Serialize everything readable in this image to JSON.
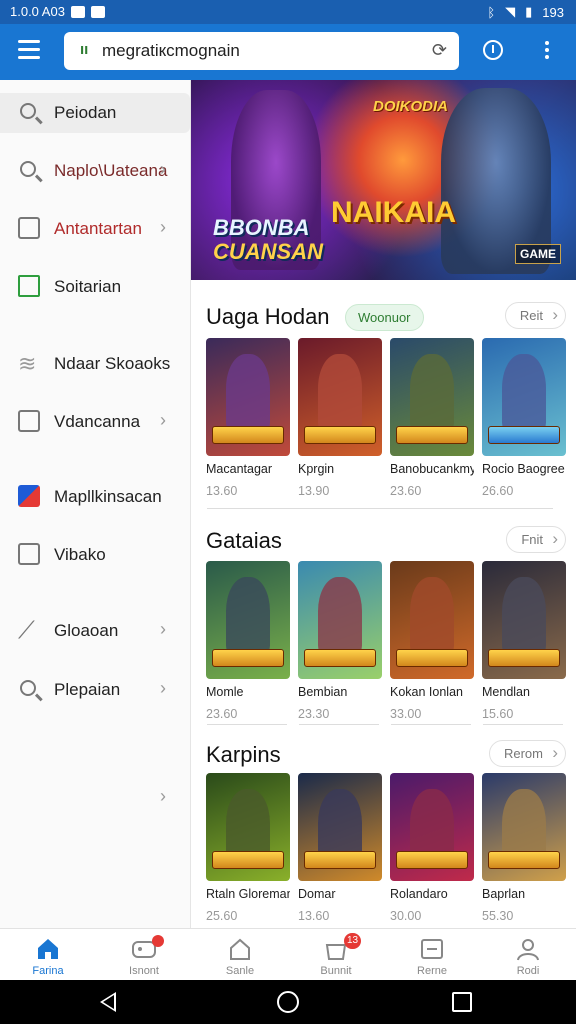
{
  "status_bar": {
    "time": "1.0.0 A03",
    "right_text": "193"
  },
  "browser": {
    "url": "megratiкcmognain"
  },
  "sidebar": {
    "search_label": "Peiodan",
    "items": [
      {
        "label": "Naplo\\Uateana",
        "icon": "search-icon",
        "color": "#7a2a2a"
      },
      {
        "label": "Antantartan",
        "icon": "grid-icon",
        "color": "#b02a2a"
      },
      {
        "label": "Soitarian",
        "icon": "image-icon",
        "color": "#222222"
      },
      {
        "label": "Ndaar Skoaoks",
        "icon": "wave-icon",
        "color": "#222222"
      },
      {
        "label": "Vdancanna",
        "icon": "check-box-icon",
        "color": "#222222"
      },
      {
        "label": "Mapllkinsacan",
        "icon": "flag-icon",
        "color": "#222222"
      },
      {
        "label": "Vibako",
        "icon": "doc-icon",
        "color": "#222222"
      },
      {
        "label": "Gloaoan",
        "icon": "pen-icon",
        "color": "#222222"
      },
      {
        "label": "Plepaian",
        "icon": "search-icon",
        "color": "#222222"
      }
    ]
  },
  "hero": {
    "top_title": "DOIKODIA",
    "main_title": "NAIKAIA",
    "left_title_1": "BBONBA",
    "left_title_2": "CUANSAN",
    "badge": "GAME"
  },
  "sections": [
    {
      "title": "Uaga Hodan",
      "pill": "Woonuor",
      "more": "Reit",
      "cards": [
        {
          "name": "Macantagar",
          "price": "13.60",
          "colors": [
            "#3a2a5a",
            "#c04a3a"
          ]
        },
        {
          "name": "Kprgin",
          "price": "13.90",
          "colors": [
            "#6a1a2a",
            "#d0602a"
          ]
        },
        {
          "name": "Banobucankmy",
          "price": "23.60",
          "colors": [
            "#2a4a6a",
            "#6a8a3a"
          ]
        },
        {
          "name": "Rocio Baogree",
          "price": "26.60",
          "colors": [
            "#2a6ab0",
            "#6ac0d0"
          ]
        }
      ]
    },
    {
      "title": "Gataias",
      "more": "Fnit",
      "cards": [
        {
          "name": "Momle",
          "price": "23.60",
          "colors": [
            "#2a5a4a",
            "#7ab04a"
          ]
        },
        {
          "name": "Bembian",
          "price": "23.30",
          "colors": [
            "#3a8ab0",
            "#9ad06a"
          ]
        },
        {
          "name": "Kokan Ionlan",
          "price": "33.00",
          "colors": [
            "#6a3a1a",
            "#d06a2a"
          ]
        },
        {
          "name": "Mendlan",
          "price": "15.60",
          "colors": [
            "#2a2a3a",
            "#8a6a4a"
          ]
        }
      ]
    },
    {
      "title": "Karpins",
      "more": "Rerom",
      "cards": [
        {
          "name": "Rtaln Gloreman",
          "price": "25.60",
          "colors": [
            "#2a4a1a",
            "#8ab02a"
          ]
        },
        {
          "name": "Domar",
          "price": "13.60",
          "colors": [
            "#1a2a4a",
            "#d08a2a"
          ]
        },
        {
          "name": "Rolandaro",
          "price": "30.00",
          "colors": [
            "#4a1a6a",
            "#c02a4a"
          ]
        },
        {
          "name": "Baprlan",
          "price": "55.30",
          "colors": [
            "#2a3a6a",
            "#d0a04a"
          ]
        }
      ]
    }
  ],
  "bottom_nav": [
    {
      "label": "Farina",
      "icon": "home-icon",
      "active": true,
      "badge": ""
    },
    {
      "label": "Isnont",
      "icon": "gamepad-icon",
      "active": false,
      "badge": ""
    },
    {
      "label": "Sanle",
      "icon": "house-outline-icon",
      "active": false,
      "badge": ""
    },
    {
      "label": "Bunnit",
      "icon": "bag-icon",
      "active": false,
      "badge": "13"
    },
    {
      "label": "Rerne",
      "icon": "box-icon",
      "active": false,
      "badge": ""
    },
    {
      "label": "Rodi",
      "icon": "person-icon",
      "active": false,
      "badge": ""
    }
  ]
}
